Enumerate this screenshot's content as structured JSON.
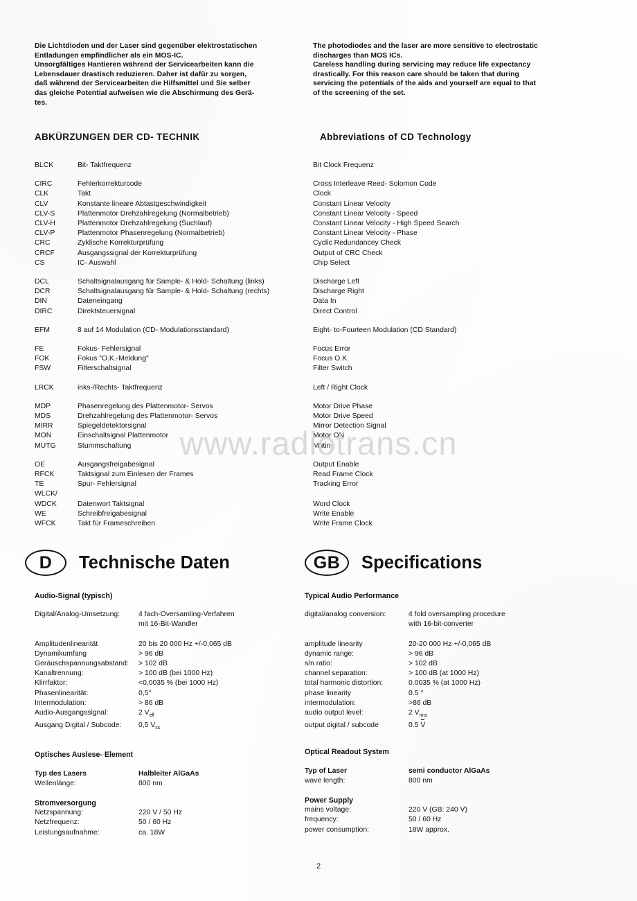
{
  "watermark": "www.radiotrans.cn",
  "page_number": "2",
  "warning": {
    "de": [
      "Die Lichtdioden und der Laser sind gegenüber elektrostatischen",
      "Entladungen empfindlicher als ein MOS-IC.",
      "Unsorgfältiges Hantieren während der Servicearbeiten kann die",
      "Lebensdauer drastisch reduzieren. Daher ist dafür zu sorgen,",
      "daß während der Servicearbeiten die Hilfsmittel und Sie selber",
      "das gleiche Potential aufweisen wie die Abschirmung des Gerä-",
      "tes."
    ],
    "en": [
      "The photodiodes and the laser are more sensitive to electrostatic",
      "discharges than MOS ICs.",
      "Careless handling during servicing may reduce life expectancy",
      "drastically. For this reason care should be taken that during",
      "servicing the potentials of the aids and yourself are equal to that",
      "of the screening of the set."
    ]
  },
  "abbrev": {
    "title_de": "ABKÜRZUNGEN DER CD- TECHNIK",
    "title_en": "Abbreviations of CD Technology",
    "groups": [
      {
        "rows": [
          {
            "key": "BLCK",
            "de": "Bit- Taktfrequenz",
            "en": "Bit Clock Frequenz"
          }
        ]
      },
      {
        "rows": [
          {
            "key": "CIRC",
            "de": "Fehlerkorrekturcode",
            "en": "Cross Interleave Reed- Solomon Code"
          },
          {
            "key": "CLK",
            "de": "Takt",
            "en": "Clock"
          },
          {
            "key": "CLV",
            "de": "Konstante lineare Abtastgeschwindigkeit",
            "en": "Constant Linear Velocity"
          },
          {
            "key": "CLV-S",
            "de": "Plattenmotor Drehzahlregelung (Normalbetrieb)",
            "en": "Constant Linear Velocity - Speed"
          },
          {
            "key": "CLV-H",
            "de": "Plattenmotor Drehzahlregelung (Suchlauf)",
            "en": "Constant Linear Velocity - High Speed Search"
          },
          {
            "key": "CLV-P",
            "de": "Plattenmotor Phasenregelung (Normalbetrieb)",
            "en": "Constant Linear Velocity - Phase"
          },
          {
            "key": "CRC",
            "de": "Zyklische Korrekturprüfung",
            "en": "Cyclic Redundancey Check"
          },
          {
            "key": "CRCF",
            "de": "Ausgangssignal der Korrekturprüfung",
            "en": "Output of CRC Check"
          },
          {
            "key": "CS",
            "de": "IC- Auswahl",
            "en": "Chip Select"
          }
        ]
      },
      {
        "rows": [
          {
            "key": "DCL",
            "de": "Schaltsignalausgang für Sample- & Hold- Schaltung (links)",
            "en": "Discharge Left"
          },
          {
            "key": "DCR",
            "de": "Schaltsignalausgang für Sample- & Hold- Schaltung (rechts)",
            "en": "Discharge Right"
          },
          {
            "key": "DIN",
            "de": "Dateneingang",
            "en": "Data In"
          },
          {
            "key": "DIRC",
            "de": "Direktsteuersignal",
            "en": "Direct Control"
          }
        ]
      },
      {
        "rows": [
          {
            "key": "EFM",
            "de": "8 auf 14 Modulation (CD- Modulationsstandard)",
            "en": "Eight- to-Fourteen Modulation (CD Standard)"
          }
        ]
      },
      {
        "rows": [
          {
            "key": "FE",
            "de": "Fokus- Fehlersignal",
            "en": "Focus Error"
          },
          {
            "key": "FOK",
            "de": "Fokus \"O.K.-Meldung\"",
            "en": "Focus O.K."
          },
          {
            "key": "FSW",
            "de": "Filterschaltsignal",
            "en": "Filter Switch"
          }
        ]
      },
      {
        "rows": [
          {
            "key": "LRCK",
            "de": "inks-/Rechts- Taktfrequenz",
            "en": "Left / Right Clock"
          }
        ]
      },
      {
        "rows": [
          {
            "key": "MDP",
            "de": "Phasenregelung des Plattenmotor- Servos",
            "en": "Motor Drive Phase"
          },
          {
            "key": "MDS",
            "de": "Drehzahlregelung des Plattenmotor- Servos",
            "en": "Motor Drive Speed"
          },
          {
            "key": "MIRR",
            "de": "Spiegeldetektorsignal",
            "en": "Mirror Detection Signal"
          },
          {
            "key": "MON",
            "de": "Einschaltsignal Plattenmotor",
            "en": "Motor ON"
          },
          {
            "key": "MUTG",
            "de": "Stummschaltung",
            "en": "Muting"
          }
        ]
      },
      {
        "rows": [
          {
            "key": "OE",
            "de": "Ausgangsfreigabesignal",
            "en": "Output Enable"
          },
          {
            "key": "RFCK",
            "de": "Taktsignal zum Einlesen der Frames",
            "en": "Read Frame Clock"
          },
          {
            "key": "TE",
            "de": "Spur- Fehlersignal",
            "en": "Tracking Error"
          },
          {
            "key": "WLCK/",
            "de": "",
            "en": ""
          },
          {
            "key": "WDCK",
            "de": "Datenwort Taktsignal",
            "en": "Word Clock"
          },
          {
            "key": "WE",
            "de": "Schreibfreigabesignal",
            "en": "Write Enable"
          },
          {
            "key": "WFCK",
            "de": "Takt für Frameschreiben",
            "en": "Write Frame Clock"
          }
        ]
      }
    ]
  },
  "specs": {
    "de": {
      "badge": "D",
      "heading": "Technische Daten",
      "audio_head": "Audio-Signal (typisch)",
      "conversion_label": "Digital/Analog-Umsetzung:",
      "conversion_value_1": "4  fach-Oversamling-Verfahren",
      "conversion_value_2": "mit 16-Bit-Wandler",
      "rows": [
        {
          "label": "Amplitudenlinearität",
          "value": "20 bis 20 000 Hz +/-0,065 dB"
        },
        {
          "label": "Dynamikumfang",
          "value": "> 96  dB"
        },
        {
          "label": "Geräuschspannungsabstand:",
          "value": "> 102 dB"
        },
        {
          "label": "Kanaltrennung:",
          "value": "> 100 dB (bei 1000 Hz)"
        },
        {
          "label": "Klirrfaktor:",
          "value": "<0,0035 % (bei 1000 Hz)"
        },
        {
          "label": "Phasenlinearität:",
          "value": "0,5°"
        },
        {
          "label": "Intermodulation:",
          "value": "> 86 dB"
        },
        {
          "label": "Audio-Ausgangssignal:",
          "value": "2 V",
          "sub": "eff"
        },
        {
          "label": "Ausgang Digital / Subcode:",
          "value": "0,5 V",
          "sub": "ss"
        }
      ],
      "optical_head": "Optisches Auslese- Element",
      "optical_rows": [
        {
          "label": "Typ des Lasers",
          "value": "Halbleiter AlGaAs",
          "bold": true
        },
        {
          "label": "Wellenlänge:",
          "value": "800 nm",
          "bold": false
        }
      ],
      "power_head": "Stromversorgung",
      "power_rows": [
        {
          "label": "Netzspannung:",
          "value": "220 V / 50 Hz"
        },
        {
          "label": "Netzfrequenz:",
          "value": "50 / 60 Hz"
        },
        {
          "label": "Leistungsaufnahme:",
          "value": "ca. 18W"
        }
      ]
    },
    "en": {
      "badge": "GB",
      "heading": "Specifications",
      "audio_head": "Typical Audio Performance",
      "conversion_label": "digital/analog conversion:",
      "conversion_value_1": "4 fold oversampling procedure",
      "conversion_value_2": "with 16-bit-converter",
      "rows": [
        {
          "label": "amplitude linearity",
          "value": "20-20 000  Hz +/-0,065 dB"
        },
        {
          "label": "dynamic range:",
          "value": "> 96 dB"
        },
        {
          "label": "s/n ratio:",
          "value": "> 102 dB"
        },
        {
          "label": "channel separation:",
          "value": "> 100 dB (at 1000 Hz)"
        },
        {
          "label": "total harmonic distortion:",
          "value": "0.0035 % (at 1000 Hz)"
        },
        {
          "label": "phase linearity",
          "value": "0.5 °"
        },
        {
          "label": "intermodulation:",
          "value": ">86 dB"
        },
        {
          "label": "audio output level:",
          "value": "2 V",
          "sub": "rms"
        },
        {
          "label": "output digital / subcode",
          "value": "0.5 V",
          "overline": true
        }
      ],
      "optical_head": "Optical Readout System",
      "optical_rows": [
        {
          "label": "Typ of Laser",
          "value": "semi conductor  AlGaAs",
          "bold": true
        },
        {
          "label": "wave length:",
          "value": "800 nm",
          "bold": false
        }
      ],
      "power_head": "Power Supply",
      "power_rows": [
        {
          "label": "mains voltage:",
          "value": "220 V (GB: 240 V)"
        },
        {
          "label": "frequency:",
          "value": "50 / 60 Hz"
        },
        {
          "label": "power consumption:",
          "value": "18W approx."
        }
      ]
    }
  }
}
